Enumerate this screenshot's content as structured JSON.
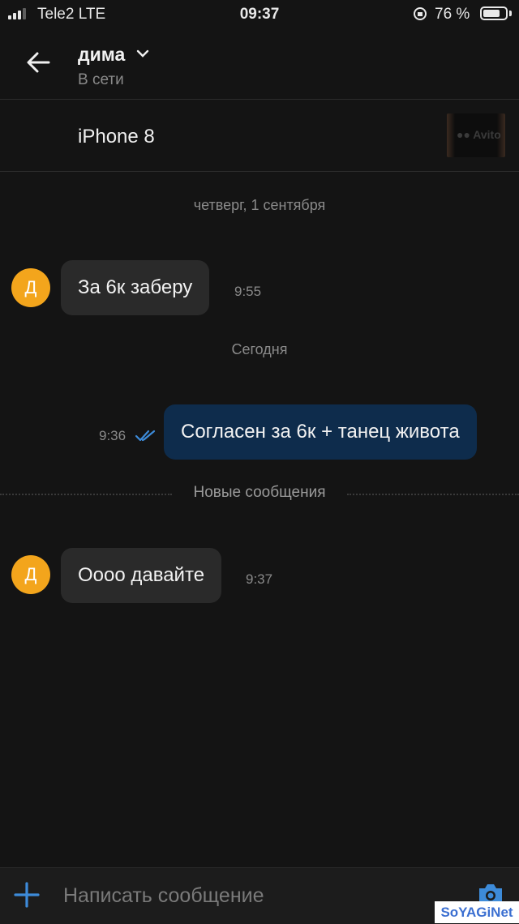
{
  "status_bar": {
    "carrier": "Tele2  LTE",
    "time": "09:37",
    "battery": "76 %",
    "battery_level": 0.76
  },
  "header": {
    "name": "дима",
    "presence": "В сети"
  },
  "item": {
    "title": "iPhone 8"
  },
  "chat": {
    "date_thursday": "четверг, 1 сентября",
    "msg1": {
      "avatar": "Д",
      "text": "За 6к заберу",
      "time": "9:55"
    },
    "date_today": "Сегодня",
    "msg2": {
      "text": "Согласен за 6к + танец живота",
      "time": "9:36"
    },
    "new_messages": "Новые сообщения",
    "msg3": {
      "avatar": "Д",
      "text": "Оооо давайте",
      "time": "9:37"
    }
  },
  "composer": {
    "placeholder": "Написать сообщение"
  },
  "watermark": "SoYAGiNet",
  "colors": {
    "avatar": "#f3a51c",
    "outgoing": "#0e2c4c",
    "incoming": "#2a2a2a",
    "accent": "#3d8bd9"
  }
}
